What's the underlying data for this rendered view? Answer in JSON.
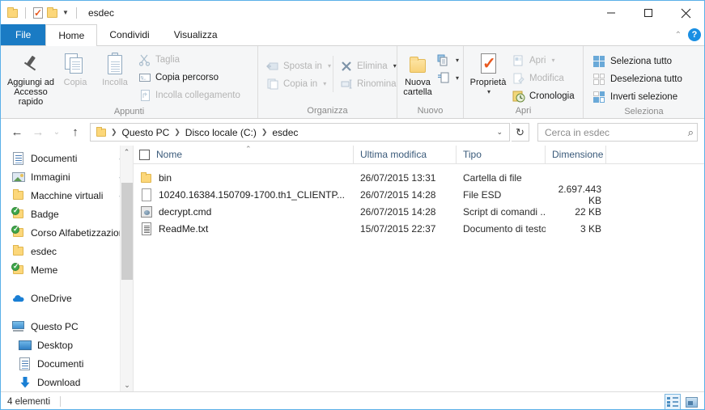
{
  "window": {
    "title": "esdec",
    "quick_access": [
      "folder-icon",
      "properties-icon",
      "new-folder-icon",
      "dropdown-caret"
    ],
    "controls": {
      "minimize": "minimize-icon",
      "maximize": "maximize-icon",
      "close": "close-icon"
    }
  },
  "tabs": {
    "file": "File",
    "items": [
      {
        "label": "Home",
        "active": true
      },
      {
        "label": "Condividi",
        "active": false
      },
      {
        "label": "Visualizza",
        "active": false
      }
    ],
    "collapse_icon": "chevron-up-icon",
    "help_icon": "?"
  },
  "ribbon": {
    "groups": [
      {
        "name": "Appunti",
        "label": "Appunti",
        "big_buttons": [
          {
            "label": "Aggiungi ad\nAccesso rapido",
            "line1": "Aggiungi ad",
            "line2": "Accesso rapido",
            "icon": "pin-icon",
            "disabled": false
          },
          {
            "label": "Copia",
            "icon": "copy-icon",
            "disabled": true
          },
          {
            "label": "Incolla",
            "icon": "paste-icon",
            "disabled": true
          }
        ],
        "small_buttons": [
          {
            "label": "Taglia",
            "icon": "scissors-icon",
            "disabled": true
          },
          {
            "label": "Copia percorso",
            "icon": "copy-path-icon",
            "disabled": false
          },
          {
            "label": "Incolla collegamento",
            "icon": "paste-shortcut-icon",
            "disabled": true
          }
        ]
      },
      {
        "name": "Organizza",
        "label": "Organizza",
        "small_buttons": [
          {
            "label": "Sposta in",
            "icon": "move-to-icon",
            "disabled": true,
            "caret": true
          },
          {
            "label": "Copia in",
            "icon": "copy-to-icon",
            "disabled": true,
            "caret": true
          },
          {
            "label": "Elimina",
            "icon": "delete-icon",
            "disabled": true,
            "caret": true
          },
          {
            "label": "Rinomina",
            "icon": "rename-icon",
            "disabled": true,
            "caret": false
          }
        ]
      },
      {
        "name": "Nuovo",
        "label": "Nuovo",
        "big_buttons": [
          {
            "line1": "Nuova",
            "line2": "cartella",
            "icon": "new-folder-icon",
            "disabled": false
          }
        ],
        "small_buttons": [
          {
            "label": "",
            "icon": "new-item-icon",
            "caret": true
          },
          {
            "label": "",
            "icon": "easy-access-icon",
            "caret": true
          }
        ]
      },
      {
        "name": "Apri",
        "label": "Apri",
        "big_buttons": [
          {
            "line1": "Proprietà",
            "line2": "",
            "icon": "properties-icon",
            "disabled": false,
            "caret": true
          }
        ],
        "small_buttons": [
          {
            "label": "Apri",
            "icon": "open-icon",
            "disabled": true,
            "caret": true
          },
          {
            "label": "Modifica",
            "icon": "edit-icon",
            "disabled": true
          },
          {
            "label": "Cronologia",
            "icon": "history-icon",
            "disabled": false
          }
        ]
      },
      {
        "name": "Seleziona",
        "label": "Seleziona",
        "small_buttons": [
          {
            "label": "Seleziona tutto",
            "icon": "select-all-icon"
          },
          {
            "label": "Deseleziona tutto",
            "icon": "select-none-icon"
          },
          {
            "label": "Inverti selezione",
            "icon": "invert-selection-icon"
          }
        ]
      }
    ]
  },
  "addressbar": {
    "back_icon": "arrow-left-icon",
    "forward_icon": "arrow-right-icon",
    "recent_icon": "chevron-down-icon",
    "up_icon": "arrow-up-icon",
    "breadcrumbs": [
      "Questo PC",
      "Disco locale (C:)",
      "esdec"
    ],
    "dropdown_icon": "chevron-down-icon",
    "refresh_icon": "refresh-icon",
    "search_placeholder": "Cerca in esdec",
    "search_value": "",
    "search_icon": "magnifier-icon"
  },
  "navpane": {
    "items": [
      {
        "label": "Documenti",
        "icon": "document-icon",
        "pinned": true,
        "indent": 0
      },
      {
        "label": "Immagini",
        "icon": "pictures-icon",
        "pinned": true,
        "indent": 0
      },
      {
        "label": "Macchine virtuali",
        "icon": "folder-icon",
        "pinned": true,
        "indent": 0
      },
      {
        "label": "Badge",
        "icon": "folder-sync-icon",
        "pinned": false,
        "indent": 0
      },
      {
        "label": "Corso Alfabetizzazione",
        "icon": "folder-sync-icon",
        "pinned": false,
        "indent": 0
      },
      {
        "label": "esdec",
        "icon": "folder-icon",
        "pinned": false,
        "indent": 0
      },
      {
        "label": "Meme",
        "icon": "folder-sync-icon",
        "pinned": false,
        "indent": 0
      },
      {
        "label": "OneDrive",
        "icon": "onedrive-icon",
        "pinned": false,
        "indent": 0,
        "gap_before": true
      },
      {
        "label": "Questo PC",
        "icon": "this-pc-icon",
        "pinned": false,
        "indent": 0,
        "gap_before": true
      },
      {
        "label": "Desktop",
        "icon": "desktop-icon",
        "pinned": false,
        "indent": 1
      },
      {
        "label": "Documenti",
        "icon": "document-icon",
        "pinned": false,
        "indent": 1
      },
      {
        "label": "Download",
        "icon": "download-icon",
        "pinned": false,
        "indent": 1
      }
    ],
    "scroll_up_icon": "chevron-up-icon",
    "scroll_down_icon": "chevron-down-icon"
  },
  "filelist": {
    "columns": [
      "Nome",
      "Ultima modifica",
      "Tipo",
      "Dimensione"
    ],
    "sort_indicator": "ascending",
    "select_all_checkbox": false,
    "rows": [
      {
        "name": "bin",
        "icon": "folder-icon",
        "modified": "26/07/2015 13:31",
        "type": "Cartella di file",
        "size": ""
      },
      {
        "name": "10240.16384.150709-1700.th1_CLIENTP...",
        "icon": "blank-file-icon",
        "modified": "26/07/2015 14:28",
        "type": "File ESD",
        "size": "2.697.443 KB"
      },
      {
        "name": "decrypt.cmd",
        "icon": "cmd-script-icon",
        "modified": "26/07/2015 14:28",
        "type": "Script di comandi ...",
        "size": "22 KB"
      },
      {
        "name": "ReadMe.txt",
        "icon": "text-file-icon",
        "modified": "15/07/2015 22:37",
        "type": "Documento di testo",
        "size": "3 KB"
      }
    ]
  },
  "statusbar": {
    "item_count": "4 elementi",
    "view_details_icon": "details-view-icon",
    "view_large_icon": "large-icons-view-icon"
  }
}
